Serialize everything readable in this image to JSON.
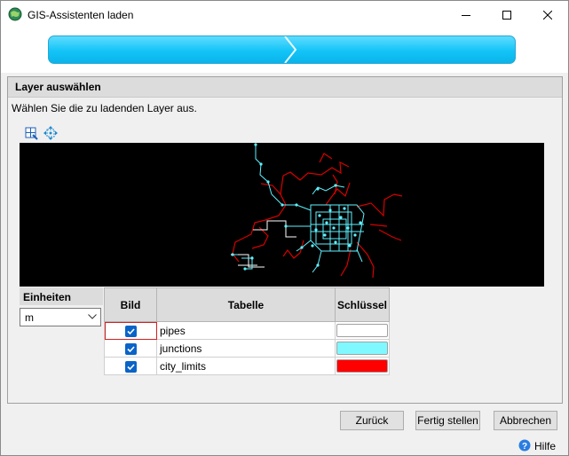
{
  "window": {
    "title": "GIS-Assistenten laden"
  },
  "panel": {
    "title": "Layer auswählen",
    "instruction": "Wählen Sie die zu ladenden Layer aus."
  },
  "units": {
    "label": "Einheiten",
    "value": "m"
  },
  "table": {
    "headers": {
      "image": "Bild",
      "table": "Tabelle",
      "key": "Schlüssel"
    },
    "rows": [
      {
        "checked": true,
        "name": "pipes",
        "color": "#ffffff"
      },
      {
        "checked": true,
        "name": "junctions",
        "color": "#7ff8ff"
      },
      {
        "checked": true,
        "name": "city_limits",
        "color": "#ff0000"
      }
    ]
  },
  "buttons": {
    "back": "Zurück",
    "finish": "Fertig stellen",
    "cancel": "Abbrechen"
  },
  "help": {
    "label": "Hilfe"
  },
  "colors": {
    "progress": "#13c4f7",
    "city_limits": "#e00000",
    "junctions": "#5ef2ff"
  },
  "icons": [
    "app-icon",
    "minimize-icon",
    "maximize-icon",
    "close-icon",
    "zoom-extent-icon",
    "pan-icon",
    "chevron-down-icon",
    "help-icon"
  ]
}
